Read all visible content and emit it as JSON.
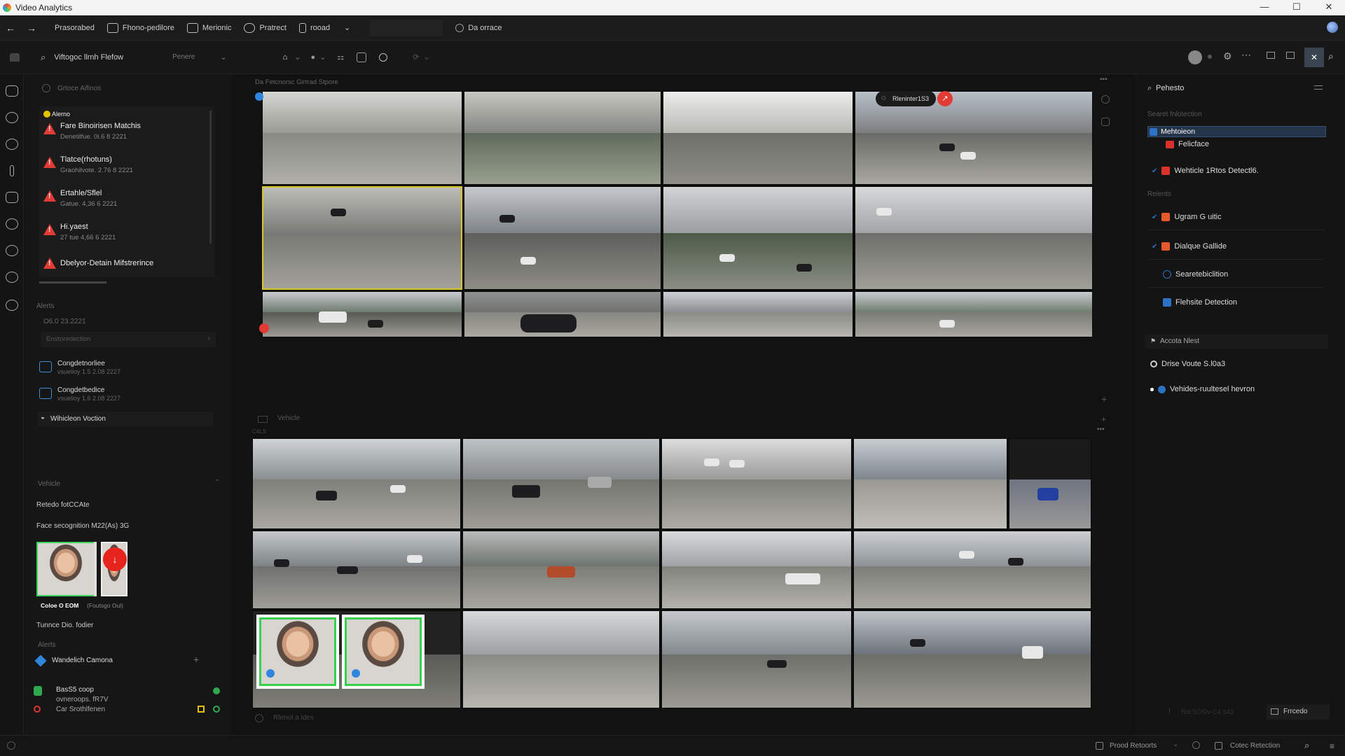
{
  "window": {
    "title": "Video Analytics",
    "controls": [
      "—",
      "☐",
      "✕"
    ]
  },
  "toolbar": {
    "items": [
      {
        "label": "Prasorabed"
      },
      {
        "label": "Fhono-pedilore"
      },
      {
        "label": "Merionic"
      },
      {
        "label": "Pratrect"
      },
      {
        "label": "rooad"
      }
    ],
    "dropdown_value": "rooad",
    "extra_label": "Da orrace"
  },
  "subtoolbar": {
    "view_title": "Viftogoc llrnh Flefow",
    "view_filter": "Penere"
  },
  "left_panel": {
    "section_top": "Grtoce Aifinos",
    "alerts_header": "Alerno",
    "alerts": [
      {
        "title": "Fare Binoirisen Matchis",
        "sub": "Denetilfue. 0i.6 8 2221"
      },
      {
        "title": "Tlatce(rhotuns)",
        "sub": "Graohilvote. 2.76 8 2221"
      },
      {
        "title": "Ertahle/Sflel",
        "sub": "Gatue. 4,36 6 2221"
      },
      {
        "title": "Hi.yaest",
        "sub": "27 tue 4,66 6 2221"
      },
      {
        "title": "Dbelyor-Detain Mifstrerince",
        "sub": ""
      }
    ],
    "alerts_section": "Alerts",
    "alerts_date": "O6.0 23.2221",
    "search_placeholder": "Enstoredection",
    "detections": [
      {
        "title": "Congdetnorliee",
        "sub": "vsuelioy 1.5 2.08 2227"
      },
      {
        "title": "Congdetbedice",
        "sub": "vsuelioy 1.6 2.08 2227"
      },
      {
        "title": "Wihicleon Voction",
        "sub": ""
      }
    ],
    "vehicle_section": "Vehicle",
    "vehicle_text": "Retedo fotCCAte",
    "face_title": "Face secognition M22(As) 3G",
    "face_caption_bold": "Coloe O EOM",
    "face_caption_rest": "(Foutsgo Oul)",
    "tunnel_label": "Tunnce Dio. fodier",
    "alerts2_label": "Alerts",
    "camera_label": "Wandelich Camona",
    "person_name": "BasS5 coop",
    "person_line2": "ovneroops. fR7V",
    "person_line3": "Car Srothlfenen"
  },
  "center": {
    "grid_top_title": "Da Fetcnorsc Girtrad Stpore",
    "badge_label": "Rleninter1S3",
    "mid_label": "Vehicle",
    "mid_sub": "C4LS",
    "bottom_label": "Rlenol a ides"
  },
  "right_panel": {
    "title": "Pehesto",
    "search_section": "Searet fnlotection",
    "highlighted": "Mehtoieon",
    "sub_selected": "Felicface",
    "vehicle_detect": "Wehticle 1Rtos Detectl6.",
    "reports_section": "Reients",
    "items": [
      {
        "label": "Ugram G uitic",
        "icon": "orange"
      },
      {
        "label": "Dialque Gallide",
        "icon": "orange"
      },
      {
        "label": "Searetebiclition",
        "icon": "shield"
      },
      {
        "label": "Flehsite Detection",
        "icon": "blue"
      }
    ],
    "access_section": "Accota Nlest",
    "access_items": [
      "Drise Voute S.l0a3",
      "Vehides-ruultesel hevron"
    ],
    "footer_filter": "Rnt 5O/Ov C4 S43",
    "footer_button": "Frrcedo"
  },
  "status": {
    "left": "Prood Retoorts",
    "right": "Cotec Retection"
  }
}
